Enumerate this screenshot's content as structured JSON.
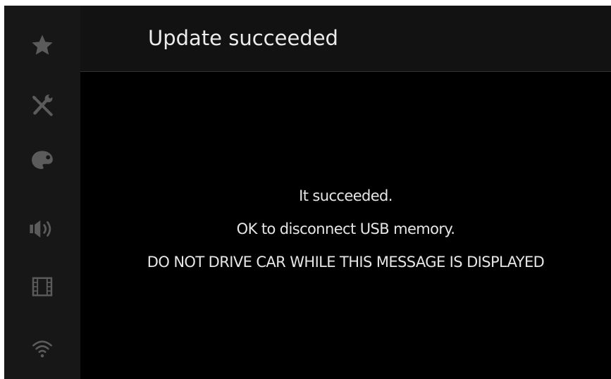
{
  "header": {
    "title": "Update succeeded"
  },
  "sidebar": {
    "items": [
      {
        "icon": "star-icon"
      },
      {
        "icon": "tools-icon"
      },
      {
        "icon": "palette-icon"
      },
      {
        "icon": "speaker-icon"
      },
      {
        "icon": "film-icon"
      },
      {
        "icon": "wifi-icon"
      }
    ],
    "icon_color": "#5b5b5b"
  },
  "message": {
    "line1": "It succeeded.",
    "line2": "OK to disconnect USB memory.",
    "line3": "DO NOT DRIVE CAR WHILE THIS MESSAGE IS DISPLAYED"
  },
  "colors": {
    "background": "#000000",
    "sidebar": "#171717",
    "header": "#121212",
    "text": "#e6e6e6"
  }
}
